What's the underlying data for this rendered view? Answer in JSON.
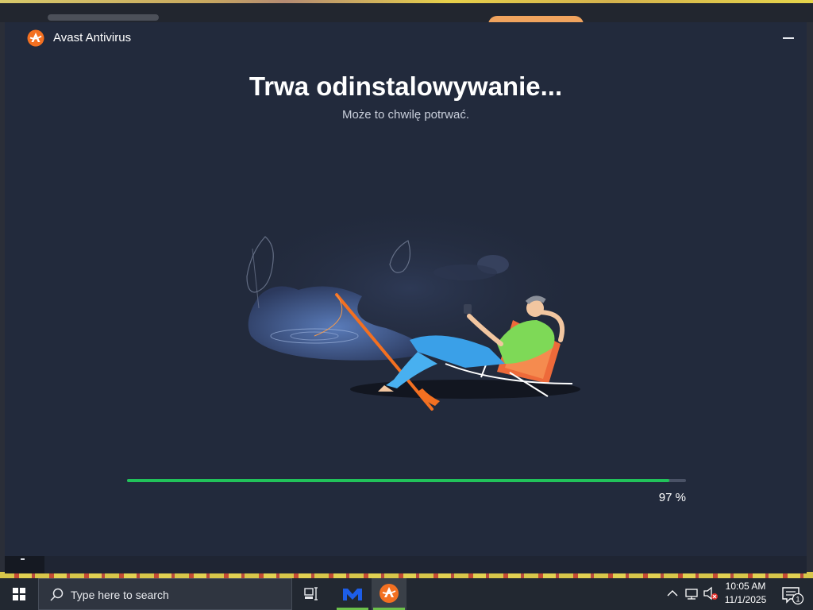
{
  "window": {
    "title": "Avast Antivirus",
    "heading": "Trwa odinstalowywanie...",
    "subheading": "Może to chwilę potrwać."
  },
  "progress": {
    "value": 97,
    "label": "97 %"
  },
  "icons": {
    "app_logo": "avast-logo-icon",
    "minimize": "minimize-icon",
    "start": "windows-start-icon",
    "search": "search-icon",
    "task_view": "task-view-icon",
    "tray_chevron": "chevron-up-icon",
    "network": "network-icon",
    "volume": "volume-muted-icon",
    "notifications": "notification-icon"
  },
  "taskbar": {
    "search_placeholder": "Type here to search",
    "apps": [
      "malwarebytes-app-icon",
      "avast-app-icon"
    ],
    "time": "10:05 AM",
    "date": "11/1/2025",
    "notification_count": "1"
  },
  "colors": {
    "window_bg": "#222a3c",
    "progress_fill": "#21c25a",
    "avast_orange": "#f37021",
    "taskbar_bg": "#222831"
  }
}
